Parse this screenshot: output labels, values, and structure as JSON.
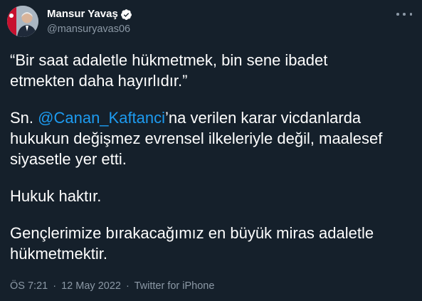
{
  "author": {
    "display_name": "Mansur Yavaş",
    "handle": "@mansuryavas06",
    "verified": true
  },
  "tweet": {
    "line1": "“Bir saat adaletle hükmetmek, bin sene ibadet",
    "line2": "etmekten daha hayırlıdır.”",
    "para2_prefix": "Sn. ",
    "mention": "@Canan_Kaftanci",
    "para2_rest_line1": "’na verilen karar vicdanlarda",
    "para2_line2": "hukukun değişmez evrensel ilkeleriyle değil, maalesef",
    "para2_line3": "siyasetle yer etti.",
    "para3": "Hukuk haktır.",
    "para4_line1": "Gençlerimize bırakacağımız en büyük miras adaletle",
    "para4_line2": "hükmetmektir."
  },
  "meta": {
    "time": "ÖS 7:21",
    "date": "12 May 2022",
    "separator": "·",
    "source": "Twitter for iPhone"
  },
  "colors": {
    "background": "#15202b",
    "text": "#ffffff",
    "secondary": "#8b98a5",
    "accent": "#1d9bf0"
  },
  "icons": {
    "verified": "verified-badge-icon",
    "more": "more-options-icon"
  }
}
